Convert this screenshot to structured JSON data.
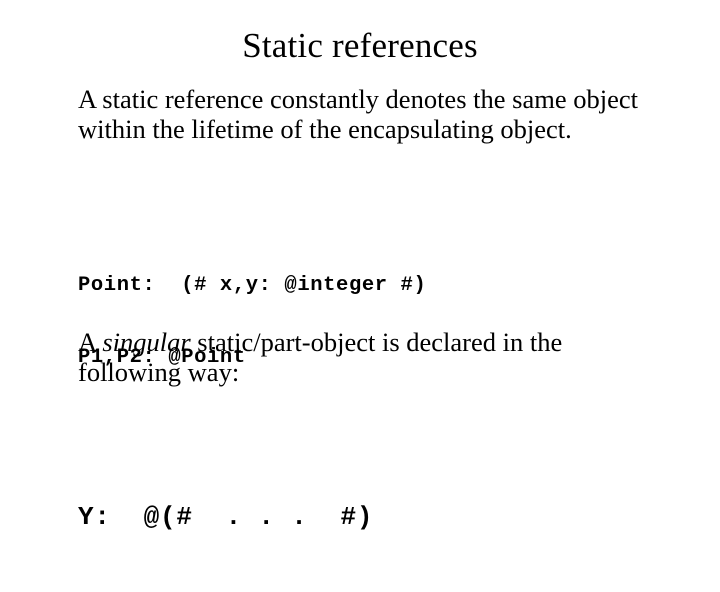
{
  "slide": {
    "title": "Static references",
    "background_color": "#ffffff",
    "text_color": "#000000",
    "paragraphs": [
      {
        "id": "definition",
        "text": "A static reference constantly denotes the same object within the lifetime of the encapsulating object."
      },
      {
        "id": "singular-intro",
        "lead": "A ",
        "emphasis": "singular",
        "tail": " static/part-object is declared in the following way:"
      }
    ],
    "code_blocks": [
      {
        "id": "point-declaration",
        "lines": [
          "Point:  (# x,y: @integer #)",
          "P1,P2: @Point"
        ]
      },
      {
        "id": "singular-declaration",
        "lines": [
          "Y:  @(#  . . .  #)"
        ]
      }
    ]
  }
}
